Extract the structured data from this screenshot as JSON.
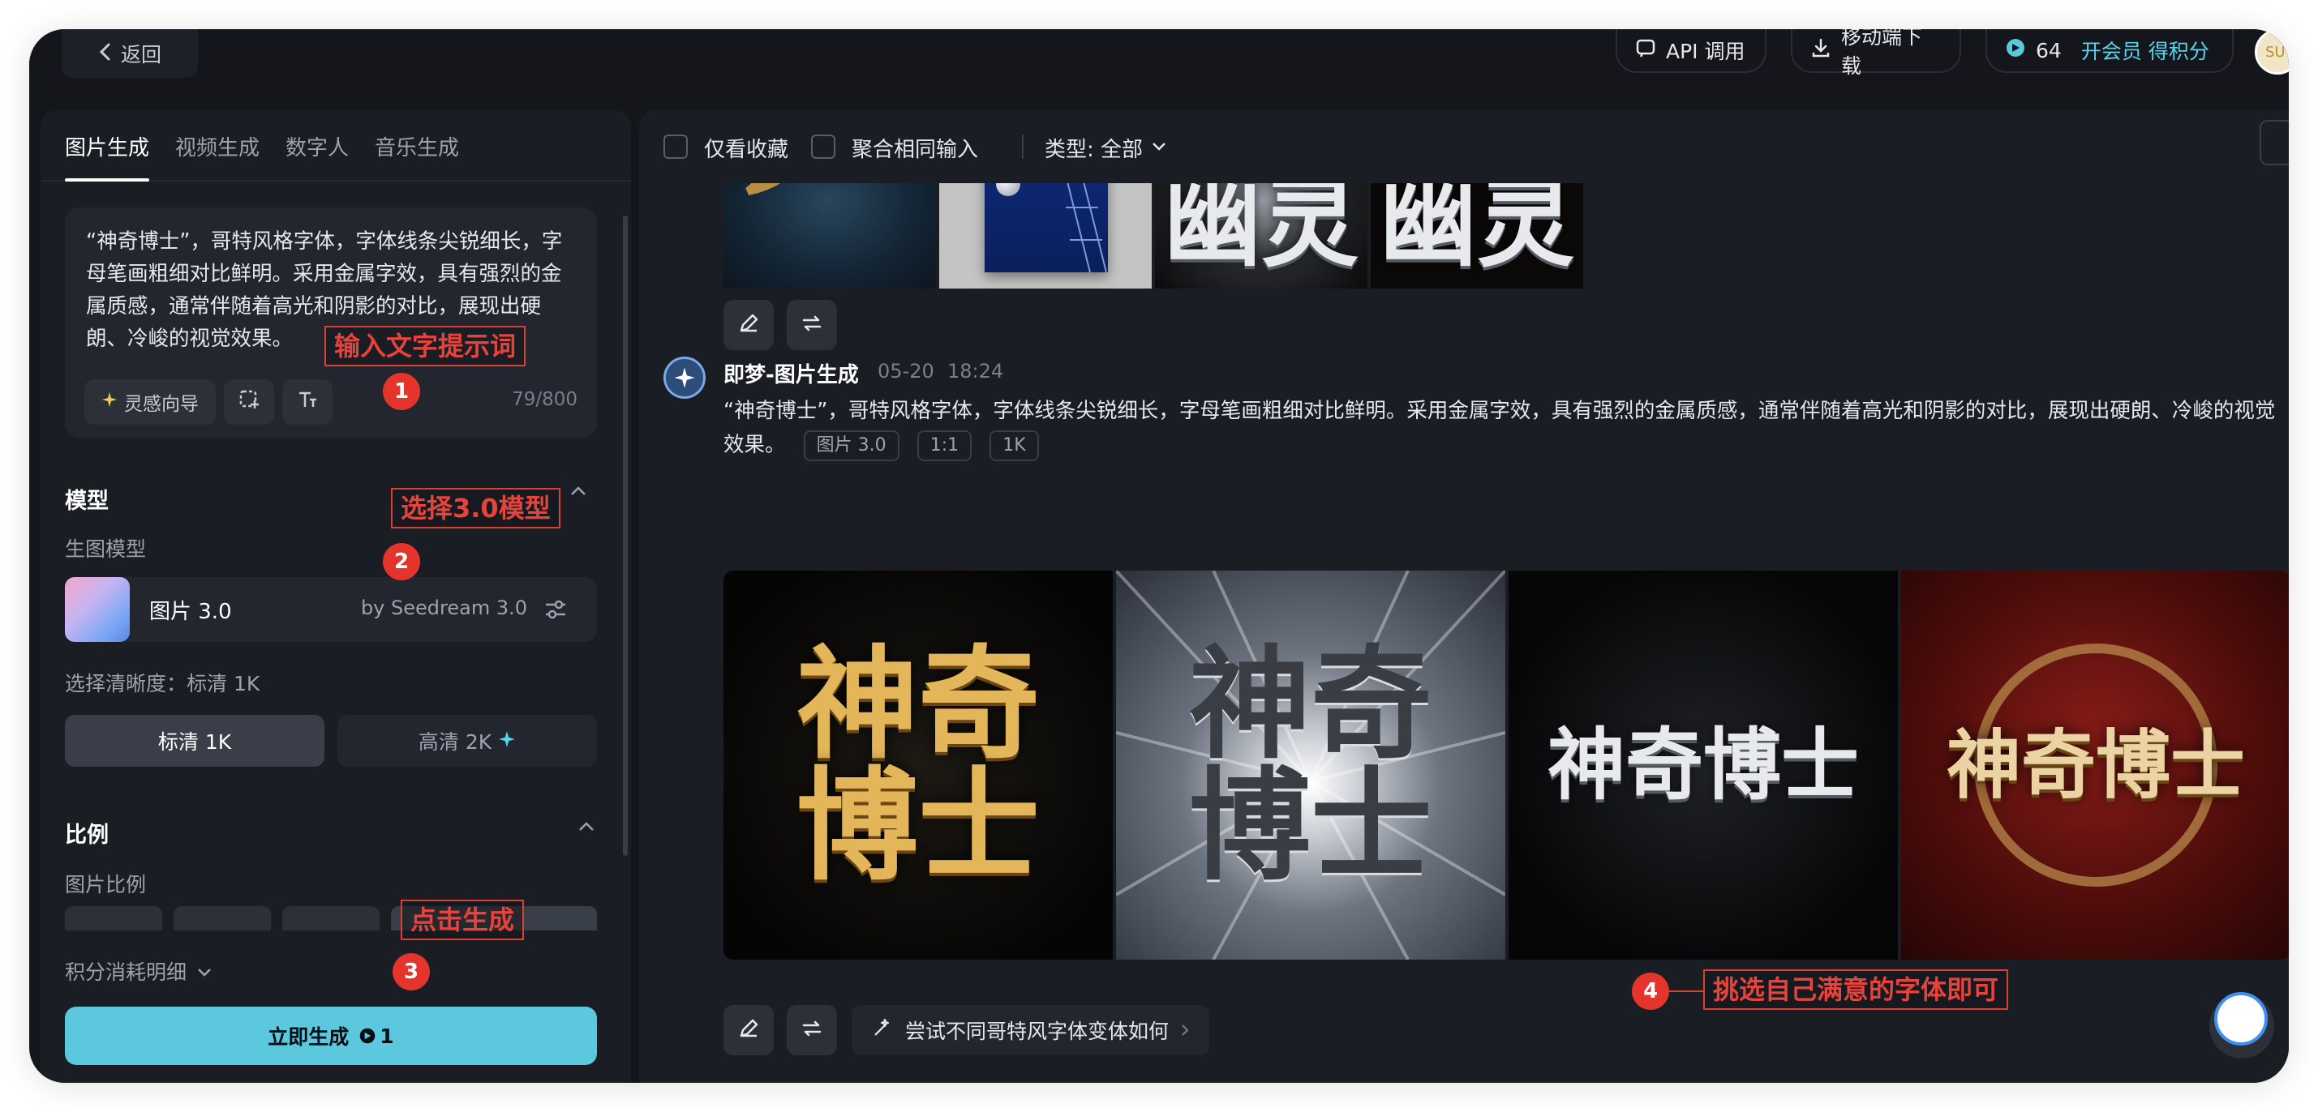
{
  "topbar": {
    "back_label": "返回",
    "api_label": "API 调用",
    "download_label": "移动端下载",
    "points": "64",
    "member_label": "开会员 得积分"
  },
  "left_panel": {
    "tabs": [
      "图片生成",
      "视频生成",
      "数字人",
      "音乐生成"
    ],
    "active_tab": "图片生成",
    "prompt": "“神奇博士”，哥特风格字体，字体线条尖锐细长，字母笔画粗细对比鲜明。采用金属字效，具有强烈的金属质感，通常伴随着高光和阴影的对比，展现出硬朗、冷峻的视觉效果。",
    "inspiration_label": "灵感向导",
    "char_count": "79/800",
    "model_section_title": "模型",
    "gen_model_label": "生图模型",
    "model_name": "图片 3.0",
    "model_by": "by Seedream 3.0",
    "resolution_label": "选择清晰度：标清 1K",
    "res_standard": "标清 1K",
    "res_high": "高清 2K",
    "ratio_section_title": "比例",
    "ratio_label": "图片比例",
    "cost_detail_label": "积分消耗明细",
    "generate_label": "立即生成",
    "generate_cost": "1"
  },
  "right_panel": {
    "filter_favorites": "仅看收藏",
    "filter_merge": "聚合相同输入",
    "filter_type": "类型: 全部",
    "prev_row_texts": [
      "幽灵",
      "幽灵"
    ],
    "message": {
      "sender": "即梦-图片生成",
      "date": "05-20",
      "time": "18:24",
      "prompt": "“神奇博士”，哥特风格字体，字体线条尖锐细长，字母笔画粗细对比鲜明。采用金属字效，具有强烈的金属质感，通常伴随着高光和阴影的对比，展现出硬朗、冷峻的视觉效果。",
      "tags": [
        "图片 3.0",
        "1:1",
        "1K"
      ],
      "image_texts": [
        "神奇\n博士",
        "神奇\n博士",
        "神奇博士",
        "神奇博士"
      ],
      "suggestion": "尝试不同哥特风字体变体如何"
    }
  },
  "annotations": [
    {
      "num": "1",
      "text": "输入文字提示词"
    },
    {
      "num": "2",
      "text": "选择3.0模型"
    },
    {
      "num": "3",
      "text": "点击生成"
    },
    {
      "num": "4",
      "text": "挑选自己满意的字体即可"
    }
  ],
  "colors": {
    "background": "#14161c",
    "panel": "#1a1d24",
    "accent": "#5cc8de",
    "annotation_red": "#e5342b"
  }
}
